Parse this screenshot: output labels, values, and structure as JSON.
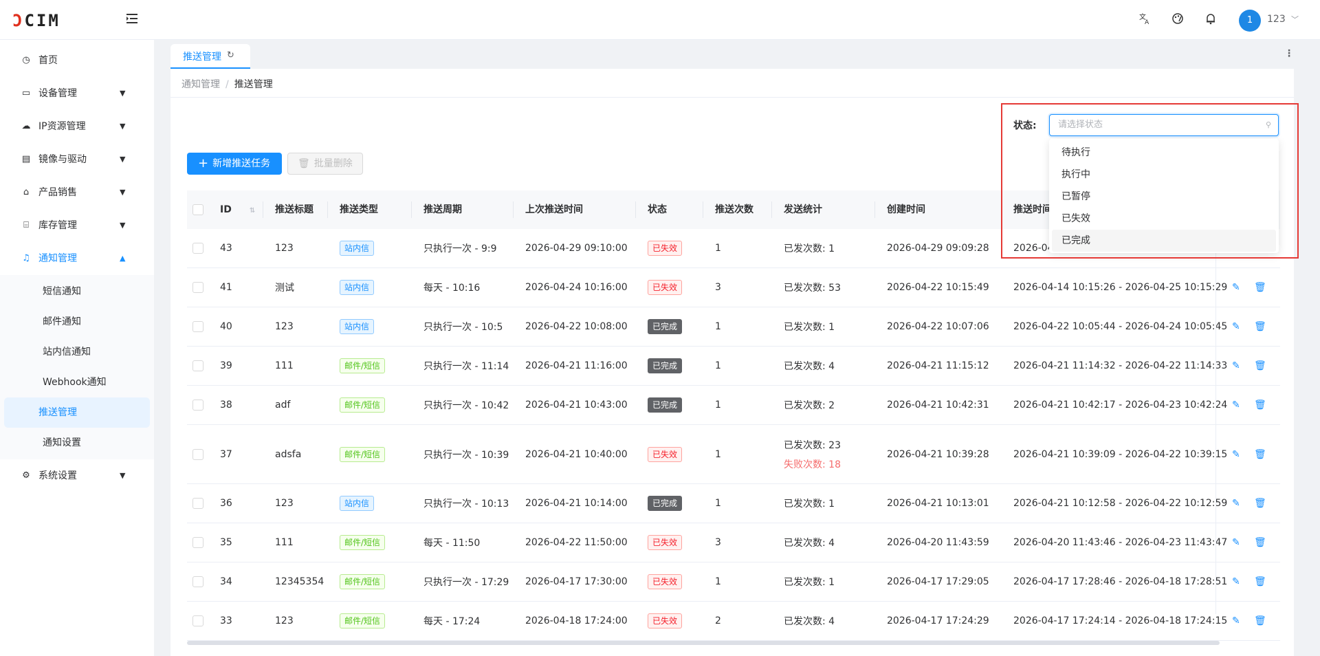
{
  "header": {
    "logo_prefix": "Ͻ",
    "logo_text": "CIM",
    "avatar_text": "1",
    "username": "123"
  },
  "sidebar": {
    "items": [
      {
        "label": "首页",
        "icon": "dashboard-icon"
      },
      {
        "label": "设备管理",
        "icon": "monitor-icon"
      },
      {
        "label": "IP资源管理",
        "icon": "cloud-icon"
      },
      {
        "label": "镜像与驱动",
        "icon": "document-icon"
      },
      {
        "label": "产品销售",
        "icon": "shop-icon"
      },
      {
        "label": "库存管理",
        "icon": "bank-icon"
      },
      {
        "label": "通知管理",
        "icon": "bell-icon"
      },
      {
        "label": "系统设置",
        "icon": "gear-icon"
      }
    ],
    "sub_items": [
      "短信通知",
      "邮件通知",
      "站内信通知",
      "Webhook通知",
      "推送管理",
      "通知设置"
    ]
  },
  "tabs": [
    {
      "label": "推送管理"
    }
  ],
  "breadcrumb": {
    "parent": "通知管理",
    "separator": "/",
    "current": "推送管理"
  },
  "toolbar": {
    "add_label": "新增推送任务",
    "batch_delete_label": "批量删除"
  },
  "filter": {
    "status_label": "状态:",
    "status_placeholder": "请选择状态",
    "options": [
      "待执行",
      "执行中",
      "已暂停",
      "已失效",
      "已完成"
    ]
  },
  "table": {
    "columns": [
      "ID",
      "推送标题",
      "推送类型",
      "推送周期",
      "上次推送时间",
      "状态",
      "推送次数",
      "发送统计",
      "创建时间",
      "推送时间"
    ],
    "rows": [
      {
        "id": "43",
        "title": "123",
        "type": "站内信",
        "cycle": "只执行一次 - 9:9",
        "last": "2026-04-29 09:10:00",
        "status": "已失效",
        "count": "1",
        "sent": "已发次数: 1",
        "failed": "",
        "created": "2026-04-29 09:09:28",
        "range": "2026-04"
      },
      {
        "id": "41",
        "title": "测试",
        "type": "站内信",
        "cycle": "每天 - 10:16",
        "last": "2026-04-24 10:16:00",
        "status": "已失效",
        "count": "3",
        "sent": "已发次数: 53",
        "failed": "",
        "created": "2026-04-22 10:15:49",
        "range": "2026-04-14 10:15:26 - 2026-04-25 10:15:29"
      },
      {
        "id": "40",
        "title": "123",
        "type": "站内信",
        "cycle": "只执行一次 - 10:5",
        "last": "2026-04-22 10:08:00",
        "status": "已完成",
        "count": "1",
        "sent": "已发次数: 1",
        "failed": "",
        "created": "2026-04-22 10:07:06",
        "range": "2026-04-22 10:05:44 - 2026-04-24 10:05:45"
      },
      {
        "id": "39",
        "title": "111",
        "type": "邮件/短信",
        "cycle": "只执行一次 - 11:14",
        "last": "2026-04-21 11:16:00",
        "status": "已完成",
        "count": "1",
        "sent": "已发次数: 4",
        "failed": "",
        "created": "2026-04-21 11:15:12",
        "range": "2026-04-21 11:14:32 - 2026-04-22 11:14:33"
      },
      {
        "id": "38",
        "title": "adf",
        "type": "邮件/短信",
        "cycle": "只执行一次 - 10:42",
        "last": "2026-04-21 10:43:00",
        "status": "已完成",
        "count": "1",
        "sent": "已发次数: 2",
        "failed": "",
        "created": "2026-04-21 10:42:31",
        "range": "2026-04-21 10:42:17 - 2026-04-23 10:42:24"
      },
      {
        "id": "37",
        "title": "adsfa",
        "type": "邮件/短信",
        "cycle": "只执行一次 - 10:39",
        "last": "2026-04-21 10:40:00",
        "status": "已失效",
        "count": "1",
        "sent": "已发次数: 23",
        "failed": "失败次数: 18",
        "created": "2026-04-21 10:39:28",
        "range": "2026-04-21 10:39:09 - 2026-04-22 10:39:15"
      },
      {
        "id": "36",
        "title": "123",
        "type": "站内信",
        "cycle": "只执行一次 - 10:13",
        "last": "2026-04-21 10:14:00",
        "status": "已完成",
        "count": "1",
        "sent": "已发次数: 1",
        "failed": "",
        "created": "2026-04-21 10:13:01",
        "range": "2026-04-21 10:12:58 - 2026-04-22 10:12:59"
      },
      {
        "id": "35",
        "title": "111",
        "type": "邮件/短信",
        "cycle": "每天 - 11:50",
        "last": "2026-04-22 11:50:00",
        "status": "已失效",
        "count": "3",
        "sent": "已发次数: 4",
        "failed": "",
        "created": "2026-04-20 11:43:59",
        "range": "2026-04-20 11:43:46 - 2026-04-23 11:43:47"
      },
      {
        "id": "34",
        "title": "12345354",
        "type": "邮件/短信",
        "cycle": "只执行一次 - 17:29",
        "last": "2026-04-17 17:30:00",
        "status": "已失效",
        "count": "1",
        "sent": "已发次数: 1",
        "failed": "",
        "created": "2026-04-17 17:29:05",
        "range": "2026-04-17 17:28:46 - 2026-04-18 17:28:51"
      },
      {
        "id": "33",
        "title": "123",
        "type": "邮件/短信",
        "cycle": "每天 - 17:24",
        "last": "2026-04-18 17:24:00",
        "status": "已失效",
        "count": "2",
        "sent": "已发次数: 4",
        "failed": "",
        "created": "2026-04-17 17:24:29",
        "range": "2026-04-17 17:24:14 - 2026-04-18 17:24:15"
      }
    ]
  },
  "colors": {
    "primary": "#1890ff",
    "danger": "#f5222d",
    "highlight_box": "#e53935"
  }
}
